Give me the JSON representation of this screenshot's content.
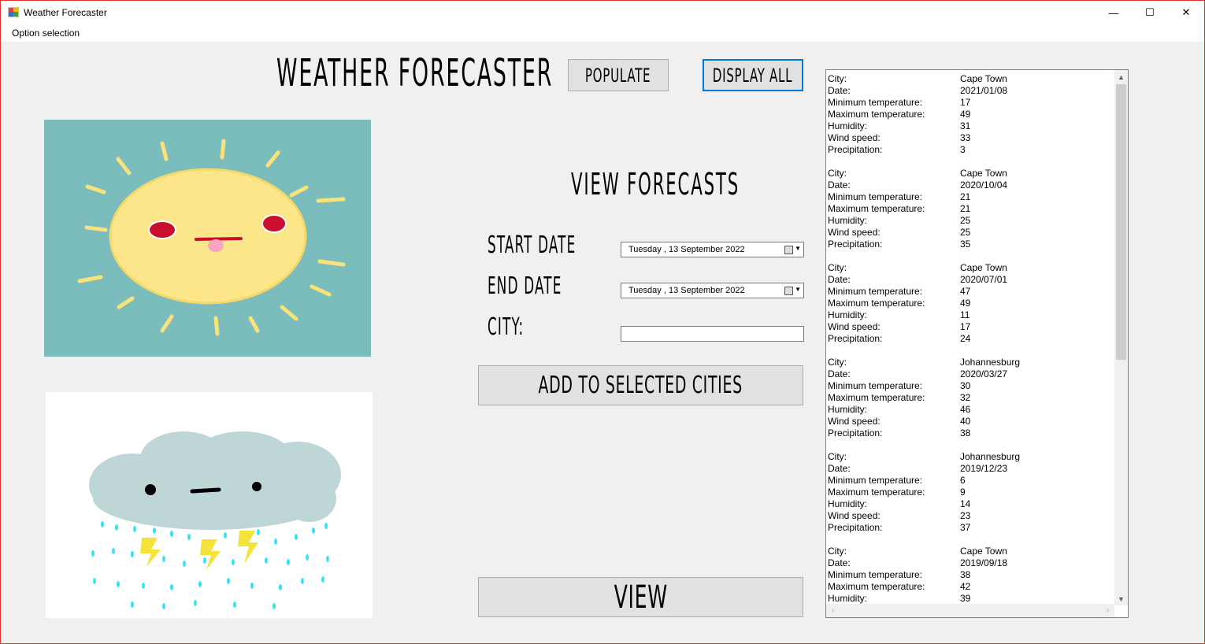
{
  "window": {
    "title": "Weather Forecaster",
    "minimize_glyph": "—",
    "maximize_glyph": "☐",
    "close_glyph": "✕"
  },
  "menu": {
    "option_selection": "Option selection"
  },
  "header": {
    "title": "Weather Forecaster",
    "populate_label": "Populate",
    "display_all_label": "Display All"
  },
  "images": {
    "top": "sun-illustration",
    "bottom": "storm-cloud-illustration"
  },
  "form": {
    "section_title": "View Forecasts",
    "start_date_label": "Start Date",
    "start_date_value": "Tuesday   , 13 September 2022",
    "end_date_label": "End Date",
    "end_date_value": "Tuesday   , 13 September 2022",
    "city_label": "City:",
    "city_value": "",
    "add_button_label": "Add to selected cities",
    "view_button_label": "View"
  },
  "records_field_labels": {
    "city": "City:",
    "date": "Date:",
    "min": "Minimum temperature:",
    "max": "Maximum temperature:",
    "humidity": "Humidity:",
    "wind": "Wind speed:",
    "precip": "Precipitation:"
  },
  "records": [
    {
      "city": "Cape Town",
      "date": "2021/01/08",
      "min": "17",
      "max": "49",
      "humidity": "31",
      "wind": "33",
      "precip": "3"
    },
    {
      "city": "Cape Town",
      "date": "2020/10/04",
      "min": "21",
      "max": "21",
      "humidity": "25",
      "wind": "25",
      "precip": "35"
    },
    {
      "city": "Cape Town",
      "date": "2020/07/01",
      "min": "47",
      "max": "49",
      "humidity": "11",
      "wind": "17",
      "precip": "24"
    },
    {
      "city": "Johannesburg",
      "date": "2020/03/27",
      "min": "30",
      "max": "32",
      "humidity": "46",
      "wind": "40",
      "precip": "38"
    },
    {
      "city": "Johannesburg",
      "date": "2019/12/23",
      "min": "6",
      "max": "9",
      "humidity": "14",
      "wind": "23",
      "precip": "37"
    },
    {
      "city": "Cape Town",
      "date": "2019/09/18",
      "min": "38",
      "max": "42",
      "humidity": "39"
    }
  ],
  "colors": {
    "sky": "#7bbcbd",
    "sun": "#fde68a",
    "sun_ray": "#f9e27a",
    "cheek": "#c8102e",
    "cloud": "#bfd6d6",
    "rain": "#3be3f0",
    "bolt": "#f5e23a",
    "focus_border": "#0078d7"
  }
}
